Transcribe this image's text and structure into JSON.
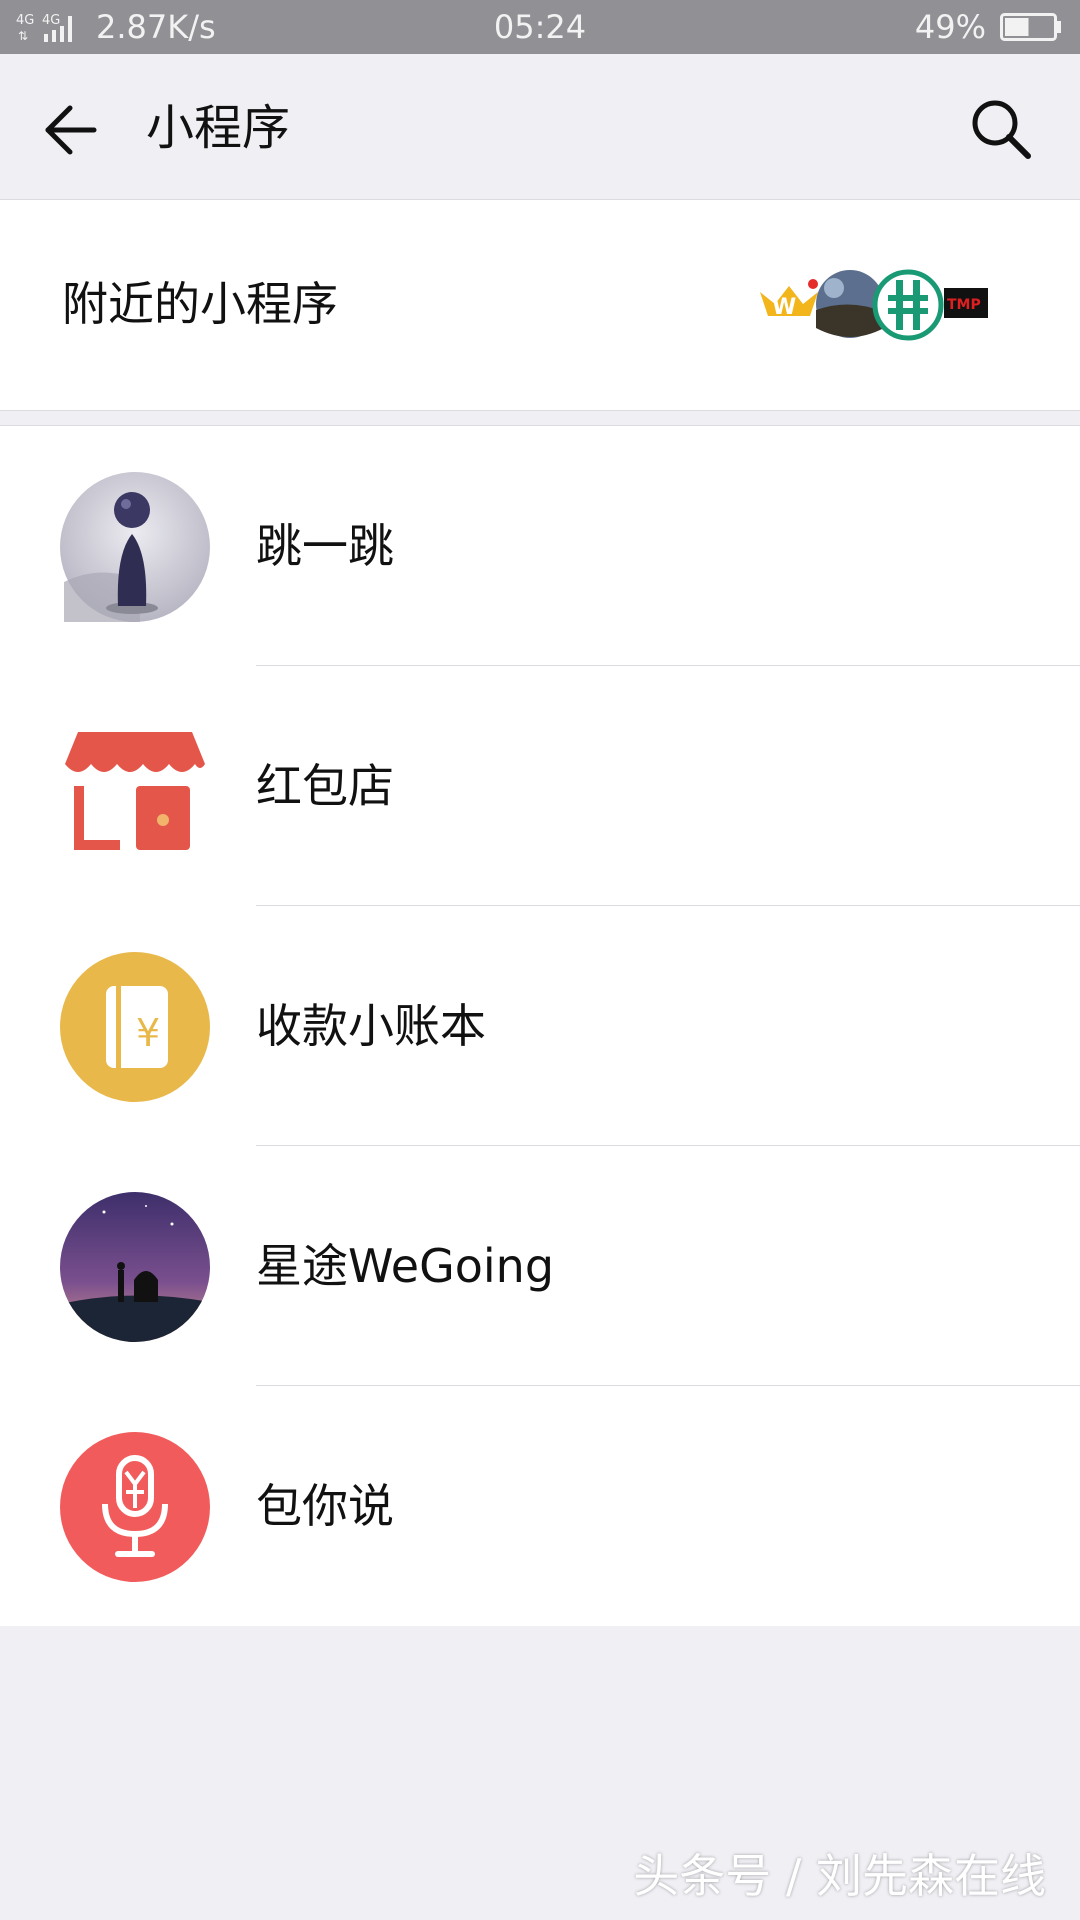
{
  "status_bar": {
    "network_1": "4G",
    "network_2": "4G",
    "speed": "2.87K/s",
    "time": "05:24",
    "battery_percent": "49%",
    "battery_level": 0.49
  },
  "nav": {
    "title": "小程序",
    "back_icon": "arrow-left-icon",
    "search_icon": "search-icon"
  },
  "nearby": {
    "label": "附近的小程序",
    "logo_text": "TMP"
  },
  "list": {
    "items": [
      {
        "name": "跳一跳",
        "icon": "jump-game-icon"
      },
      {
        "name": "红包店",
        "icon": "store-icon"
      },
      {
        "name": "收款小账本",
        "icon": "ledger-icon"
      },
      {
        "name": "星途WeGoing",
        "icon": "wegoing-icon"
      },
      {
        "name": "包你说",
        "icon": "microphone-icon"
      }
    ]
  },
  "watermark": "头条号 / 刘先森在线",
  "colors": {
    "status_bar_bg": "#909095",
    "page_bg": "#efeff4",
    "store_red": "#e5564a",
    "ledger_yellow": "#e8b84a",
    "mic_red": "#f25b5b",
    "nearby_green": "#1a9a74"
  }
}
